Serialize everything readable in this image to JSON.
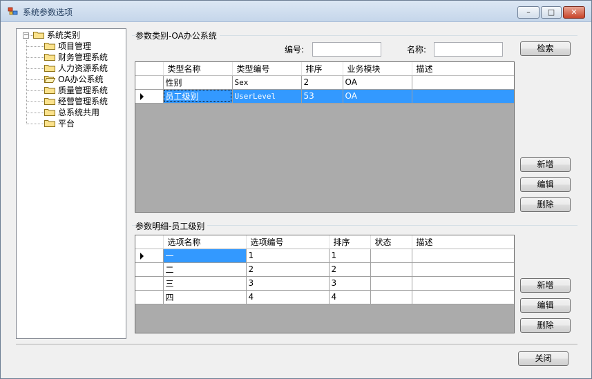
{
  "window": {
    "title": "系统参数选项",
    "minimize": "–",
    "maximize": "□",
    "close": "✕"
  },
  "tree": {
    "root": "系统类别",
    "root_expander": "−",
    "children": [
      "项目管理",
      "财务管理系统",
      "人力资源系统",
      "OA办公系统",
      "质量管理系统",
      "经营管理系统",
      "总系统共用",
      "平台"
    ]
  },
  "category_group": {
    "title": "参数类别-OA办公系统",
    "code_label": "编号:",
    "code_value": "",
    "name_label": "名称:",
    "name_value": "",
    "search_button": "检索",
    "columns": [
      "类型名称",
      "类型编号",
      "排序",
      "业务模块",
      "描述"
    ],
    "rows": [
      [
        "性别",
        "Sex",
        "2",
        "OA",
        ""
      ],
      [
        "员工级别",
        "UserLevel",
        "53",
        "OA",
        ""
      ]
    ],
    "add_button": "新增",
    "edit_button": "编辑",
    "delete_button": "删除"
  },
  "detail_group": {
    "title": "参数明细-员工级别",
    "columns": [
      "选项名称",
      "选项编号",
      "排序",
      "状态",
      "描述"
    ],
    "rows": [
      [
        "一",
        "1",
        "1",
        "",
        ""
      ],
      [
        "二",
        "2",
        "2",
        "",
        ""
      ],
      [
        "三",
        "3",
        "3",
        "",
        ""
      ],
      [
        "四",
        "4",
        "4",
        "",
        ""
      ]
    ],
    "add_button": "新增",
    "edit_button": "编辑",
    "delete_button": "删除"
  },
  "footer": {
    "close_button": "关闭"
  },
  "colors": {
    "selection": "#3399ff",
    "grid_bg": "#ababab"
  }
}
